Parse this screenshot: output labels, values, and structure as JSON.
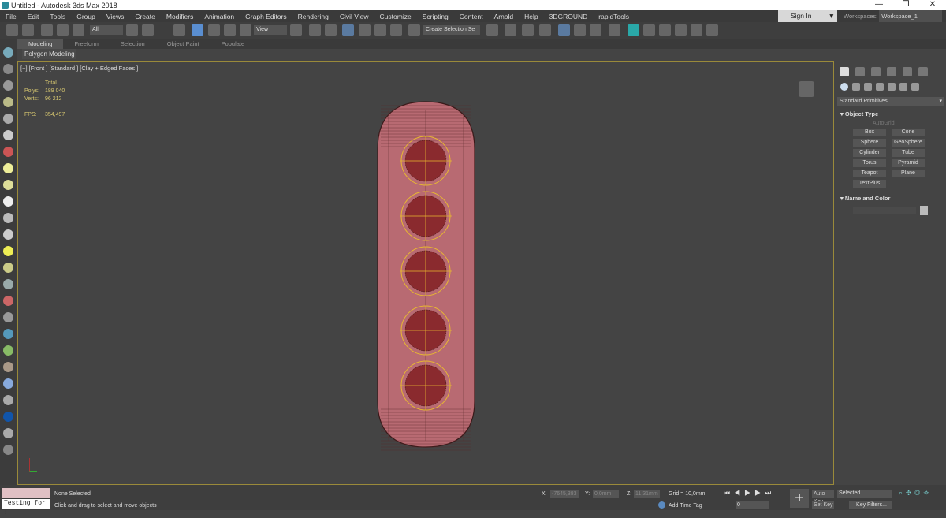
{
  "window": {
    "title": "Untitled - Autodesk 3ds Max 2018",
    "minimize": "—",
    "restore": "❐",
    "close": "✕"
  },
  "menu": [
    "File",
    "Edit",
    "Tools",
    "Group",
    "Views",
    "Create",
    "Modifiers",
    "Animation",
    "Graph Editors",
    "Rendering",
    "Civil View",
    "Customize",
    "Scripting",
    "Content",
    "Arnold",
    "Help",
    "3DGROUND",
    "rapidTools"
  ],
  "account": {
    "sign_in": "Sign In",
    "workspaces_label": "Workspaces:",
    "workspace": "Workspace_1"
  },
  "toolbar": {
    "selection_filter": "All",
    "ref_coord": "View",
    "named_selection": "Create Selection Se"
  },
  "ribbon": {
    "tabs": [
      "Modeling",
      "Freeform",
      "Selection",
      "Object Paint",
      "Populate"
    ],
    "active": "Modeling",
    "panel": "Polygon Modeling"
  },
  "viewport": {
    "label": "[+] [Front ] [Standard ] [Clay + Edged Faces ]",
    "stats": {
      "header": "Total",
      "polys_label": "Polys:",
      "polys": "189 040",
      "verts_label": "Verts:",
      "verts": "96 212",
      "fps_label": "FPS:",
      "fps": "354,497"
    },
    "border_color": "#9a8a3a",
    "object_color": "#b86a72"
  },
  "command_panel": {
    "category": "Standard Primitives",
    "rollout_object_type": "Object Type",
    "autogrid": "AutoGrid",
    "buttons": [
      "Box",
      "Cone",
      "Sphere",
      "GeoSphere",
      "Cylinder",
      "Tube",
      "Torus",
      "Pyramid",
      "Teapot",
      "Plane",
      "TextPlus"
    ],
    "rollout_name_color": "Name and Color"
  },
  "status": {
    "maxscript": "Testing for :",
    "selection": "None Selected",
    "prompt": "Click and drag to select and move objects",
    "x_label": "X:",
    "x": "-7645,383",
    "y_label": "Y:",
    "y": "0,0mm",
    "z_label": "Z:",
    "z": "11,31mm",
    "grid": "Grid = 10,0mm",
    "add_time_tag": "Add Time Tag",
    "frame": "0",
    "auto_key": "Auto Key",
    "set_key": "Set Key",
    "key_mode": "Selected",
    "key_filters": "Key Filters..."
  }
}
